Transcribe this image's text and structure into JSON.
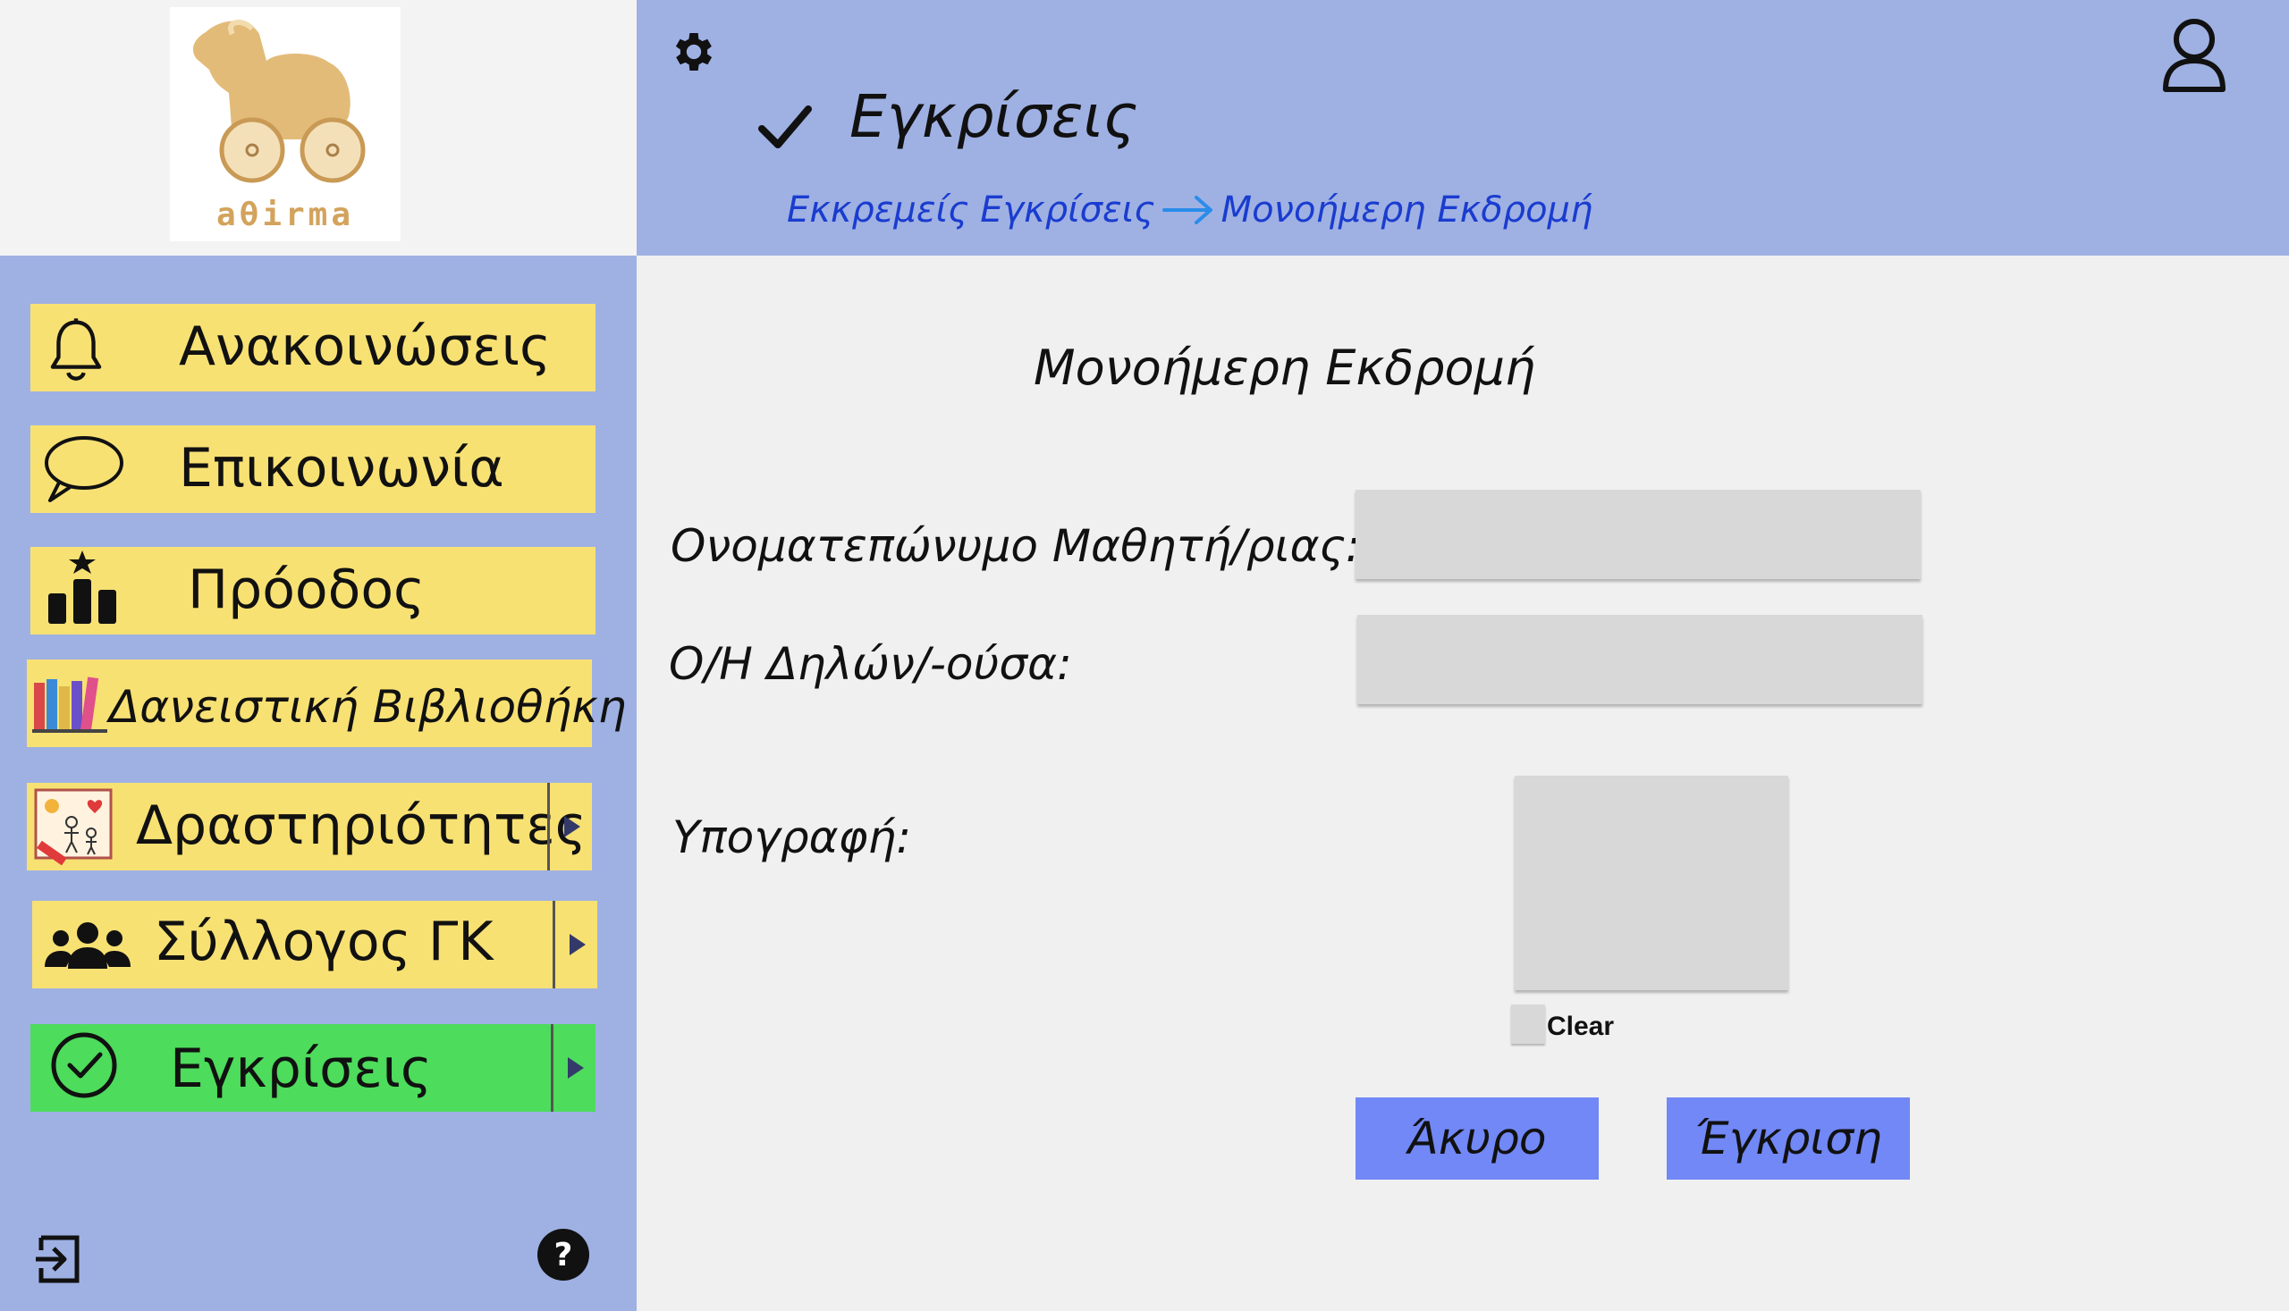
{
  "logo": {
    "text": "aθirma"
  },
  "header": {
    "title": "Εγκρίσεις",
    "breadcrumb": [
      "Εκκρεμείς Εγκρίσεις",
      "Μονοήμερη Εκδρομή"
    ]
  },
  "sidebar": {
    "items": [
      {
        "label": "Ανακοινώσεις",
        "icon": "bell-icon"
      },
      {
        "label": "Επικοινωνία",
        "icon": "chat-bubble-icon"
      },
      {
        "label": "Πρόοδος",
        "icon": "podium-star-icon"
      },
      {
        "label": "Δανειστική Βιβλιοθήκη",
        "icon": "books-icon"
      },
      {
        "label": "Δραστηριότητες",
        "icon": "kids-drawing-icon",
        "has_submenu": true
      },
      {
        "label": "Σύλλογος ΓΚ",
        "icon": "group-icon",
        "has_submenu": true
      },
      {
        "label": "Εγκρίσεις",
        "icon": "check-circle-icon",
        "has_submenu": true,
        "active": true
      }
    ]
  },
  "form": {
    "title": "Μονοήμερη Εκδρομή",
    "student_label": "Ονοματεπώνυμο Μαθητή/ριας:",
    "student_value": "",
    "declarant_label": "Ο/Η Δηλών/-ούσα:",
    "declarant_value": "",
    "signature_label": "Υπογραφή:",
    "clear_label": "Clear",
    "cancel_label": "Άκυρο",
    "approve_label": "Έγκριση"
  },
  "colors": {
    "header_bg": "#9fb1e3",
    "nav_item": "#f8e173",
    "nav_active": "#4ddc5c",
    "button": "#7188f6",
    "breadcrumb_link": "#1a3ccf"
  }
}
